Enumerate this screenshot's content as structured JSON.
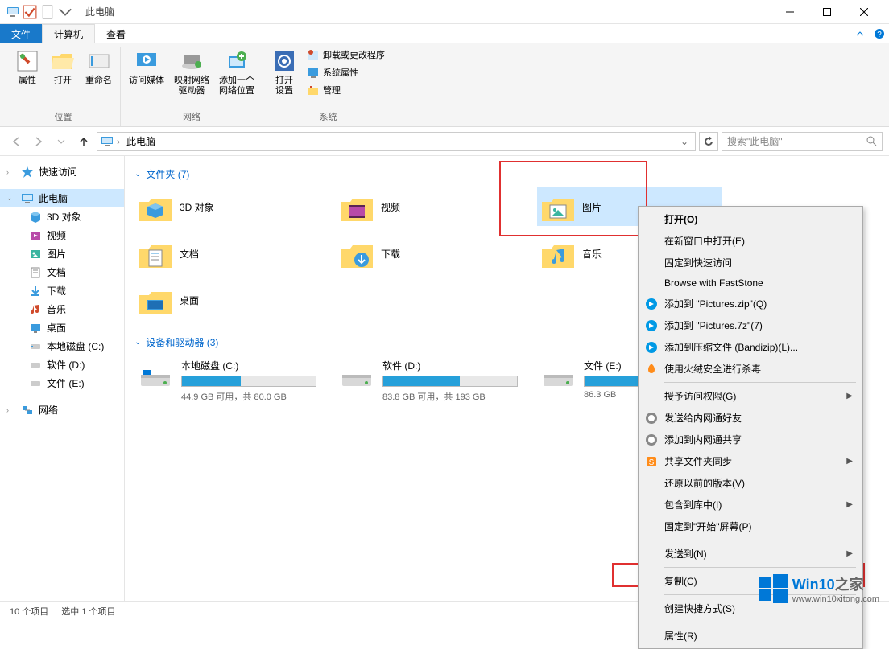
{
  "title": "此电脑",
  "ribbon_tabs": {
    "file": "文件",
    "computer": "计算机",
    "view": "查看"
  },
  "ribbon": {
    "location": {
      "label": "位置",
      "properties": "属性",
      "open": "打开",
      "rename": "重命名"
    },
    "network": {
      "label": "网络",
      "access_media": "访问媒体",
      "map_drive": "映射网络\n驱动器",
      "add_location": "添加一个\n网络位置"
    },
    "system": {
      "label": "系统",
      "open_settings": "打开\n设置",
      "uninstall": "卸载或更改程序",
      "sys_props": "系统属性",
      "manage": "管理"
    }
  },
  "address": {
    "path": "此电脑"
  },
  "search": {
    "placeholder": "搜索\"此电脑\""
  },
  "sidebar": {
    "quick_access": "快速访问",
    "this_pc": "此电脑",
    "items": [
      "3D 对象",
      "视频",
      "图片",
      "文档",
      "下载",
      "音乐",
      "桌面",
      "本地磁盘 (C:)",
      "软件 (D:)",
      "文件 (E:)"
    ],
    "network": "网络"
  },
  "groups": {
    "folders": {
      "header": "文件夹 (7)",
      "items": [
        "3D 对象",
        "视频",
        "图片",
        "文档",
        "下载",
        "音乐",
        "桌面"
      ]
    },
    "drives": {
      "header": "设备和驱动器 (3)",
      "items": [
        {
          "name": "本地磁盘 (C:)",
          "free": "44.9 GB 可用，共 80.0 GB",
          "pct": 44
        },
        {
          "name": "软件 (D:)",
          "free": "83.8 GB 可用，共 193 GB",
          "pct": 57
        },
        {
          "name": "文件 (E:)",
          "free": "86.3 GB",
          "pct": 40
        }
      ]
    }
  },
  "ctx": {
    "open": "打开(O)",
    "open_new": "在新窗口中打开(E)",
    "pin_quick": "固定到快速访问",
    "faststone": "Browse with FastStone",
    "add_zip": "添加到 \"Pictures.zip\"(Q)",
    "add_7z": "添加到 \"Pictures.7z\"(7)",
    "add_bandizip": "添加到压缩文件 (Bandizip)(L)...",
    "huorong": "使用火绒安全进行杀毒",
    "grant_access": "授予访问权限(G)",
    "send_intranet": "发送给内网通好友",
    "add_intranet_share": "添加到内网通共享",
    "sync_shared": "共享文件夹同步",
    "restore": "还原以前的版本(V)",
    "include_lib": "包含到库中(I)",
    "pin_start": "固定到\"开始\"屏幕(P)",
    "send_to": "发送到(N)",
    "copy": "复制(C)",
    "shortcut": "创建快捷方式(S)",
    "properties": "属性(R)"
  },
  "status": {
    "count": "10 个项目",
    "selected": "选中 1 个项目"
  },
  "watermark": {
    "title_a": "Win10",
    "title_b": "之家",
    "url": "www.win10xitong.com"
  }
}
